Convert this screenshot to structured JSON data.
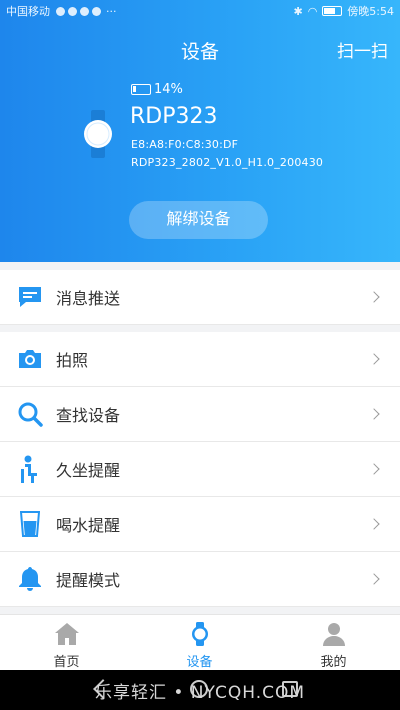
{
  "status_bar": {
    "carrier": "中国移动",
    "time": "傍晚5:54"
  },
  "header": {
    "title": "设备",
    "scan_label": "扫一扫"
  },
  "device": {
    "battery": "14%",
    "name": "RDP323",
    "mac": "E8:A8:F0:C8:30:DF",
    "firmware": "RDP323_2802_V1.0_H1.0_200430",
    "unbind_label": "解绑设备"
  },
  "menu": {
    "push": "消息推送",
    "photo": "拍照",
    "find": "查找设备",
    "sedentary": "久坐提醒",
    "water": "喝水提醒",
    "reminder_mode": "提醒模式"
  },
  "tabs": {
    "home": "首页",
    "device": "设备",
    "mine": "我的"
  },
  "watermark": "乐享轻汇 • NYCQH.COM",
  "colors": {
    "accent": "#2496f1",
    "header_start": "#1e86ec",
    "header_end": "#37b6fb"
  }
}
